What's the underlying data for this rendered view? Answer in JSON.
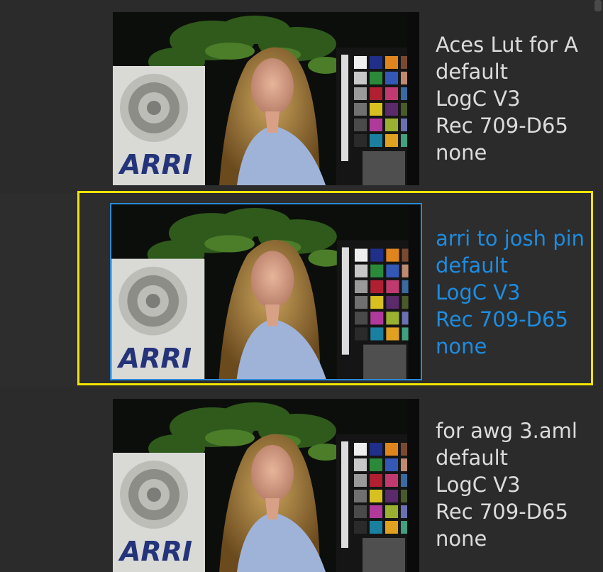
{
  "presets": [
    {
      "name": "Aces Lut for A",
      "lines": [
        "default",
        "LogC V3",
        "Rec 709-D65",
        "none"
      ],
      "logo": "ARRI",
      "selected": false
    },
    {
      "name": "arri to josh pin",
      "lines": [
        "default",
        "LogC V3",
        "Rec 709-D65",
        "none"
      ],
      "logo": "ARRI",
      "selected": true
    },
    {
      "name": "for awg 3.aml",
      "lines": [
        "default",
        "LogC V3",
        "Rec 709-D65",
        "none"
      ],
      "logo": "ARRI",
      "selected": false
    }
  ],
  "colors": {
    "background": "#2b2b2b",
    "text": "#dcdcdc",
    "selected_text": "#1e8ce0",
    "selection_frame": "#f2e400",
    "thumb_border": "#2b8ad6"
  }
}
